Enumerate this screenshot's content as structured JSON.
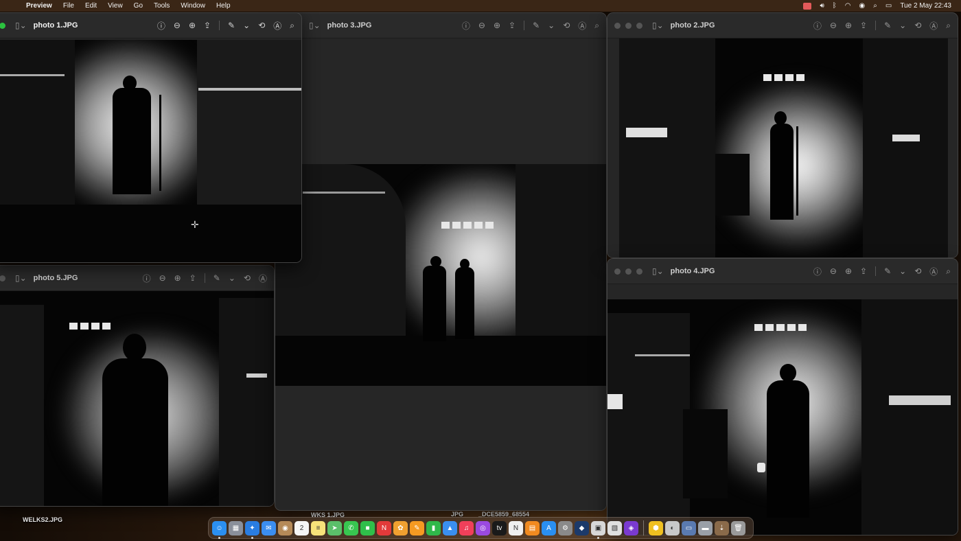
{
  "menubar": {
    "app_name": "Preview",
    "menus": [
      "File",
      "Edit",
      "View",
      "Go",
      "Tools",
      "Window",
      "Help"
    ],
    "datetime": "Tue 2 May  22:43"
  },
  "windows": {
    "photo1": {
      "title": "photo 1.JPG"
    },
    "photo3": {
      "title": "photo 3.JPG"
    },
    "photo2": {
      "title": "photo 2.JPG"
    },
    "photo4": {
      "title": "photo 4.JPG"
    },
    "photo5": {
      "title": "photo 5.JPG"
    }
  },
  "desktop_files": {
    "file1": "WELKS2.JPG",
    "file2": "WKS 1.JPG",
    "file3": "JPG",
    "file4": "_DCE5859_68554"
  },
  "dock": {
    "apps": [
      {
        "name": "finder",
        "color": "#2b8ff0",
        "glyph": "☺"
      },
      {
        "name": "launchpad",
        "color": "#8a8f9a",
        "glyph": "▦"
      },
      {
        "name": "safari",
        "color": "#2a7de1",
        "glyph": "✦"
      },
      {
        "name": "mail",
        "color": "#3b8ef0",
        "glyph": "✉"
      },
      {
        "name": "contacts",
        "color": "#b58a58",
        "glyph": "◉"
      },
      {
        "name": "calendar",
        "color": "#f5f5f5",
        "glyph": "2"
      },
      {
        "name": "notes",
        "color": "#f7e27a",
        "glyph": "≡"
      },
      {
        "name": "maps",
        "color": "#5bbf6a",
        "glyph": "➤"
      },
      {
        "name": "messages",
        "color": "#38c650",
        "glyph": "✆"
      },
      {
        "name": "facetime",
        "color": "#2fbf4a",
        "glyph": "■"
      },
      {
        "name": "news-app",
        "color": "#e23a3a",
        "glyph": "N"
      },
      {
        "name": "photos",
        "color": "#f0a030",
        "glyph": "✿"
      },
      {
        "name": "pages",
        "color": "#f59a22",
        "glyph": "✎"
      },
      {
        "name": "numbers",
        "color": "#2fb84a",
        "glyph": "▮"
      },
      {
        "name": "keynote",
        "color": "#3a8ff0",
        "glyph": "▲"
      },
      {
        "name": "music",
        "color": "#f0405a",
        "glyph": "♫"
      },
      {
        "name": "podcasts",
        "color": "#9a4ae0",
        "glyph": "◎"
      },
      {
        "name": "apple-tv",
        "color": "#1a1a1a",
        "glyph": "tv"
      },
      {
        "name": "news",
        "color": "#f0f0f0",
        "glyph": "N"
      },
      {
        "name": "books",
        "color": "#f08a20",
        "glyph": "▤"
      },
      {
        "name": "app-store",
        "color": "#2a8ff0",
        "glyph": "A"
      },
      {
        "name": "system-settings",
        "color": "#8a8a8a",
        "glyph": "⚙"
      },
      {
        "name": "affinity-designer",
        "color": "#1c3a6a",
        "glyph": "◆"
      },
      {
        "name": "preview",
        "color": "#d8d8d8",
        "glyph": "▣"
      },
      {
        "name": "photo-viewer",
        "color": "#e0e0e0",
        "glyph": "▧"
      },
      {
        "name": "affinity-photo",
        "color": "#7a3ad0",
        "glyph": "◈"
      }
    ],
    "extras": [
      {
        "name": "hexagon-app",
        "color": "#f0c020",
        "glyph": "⬢"
      },
      {
        "name": "disk-utility",
        "color": "#c8c8c8",
        "glyph": "◐"
      },
      {
        "name": "finder-window",
        "color": "#5a7ab0",
        "glyph": "▭"
      },
      {
        "name": "folder",
        "color": "#9aa0a8",
        "glyph": "▬"
      },
      {
        "name": "downloads",
        "color": "#8a6a4a",
        "glyph": "⇣"
      },
      {
        "name": "trash",
        "color": "#9a9a9a",
        "glyph": "🗑"
      }
    ]
  }
}
